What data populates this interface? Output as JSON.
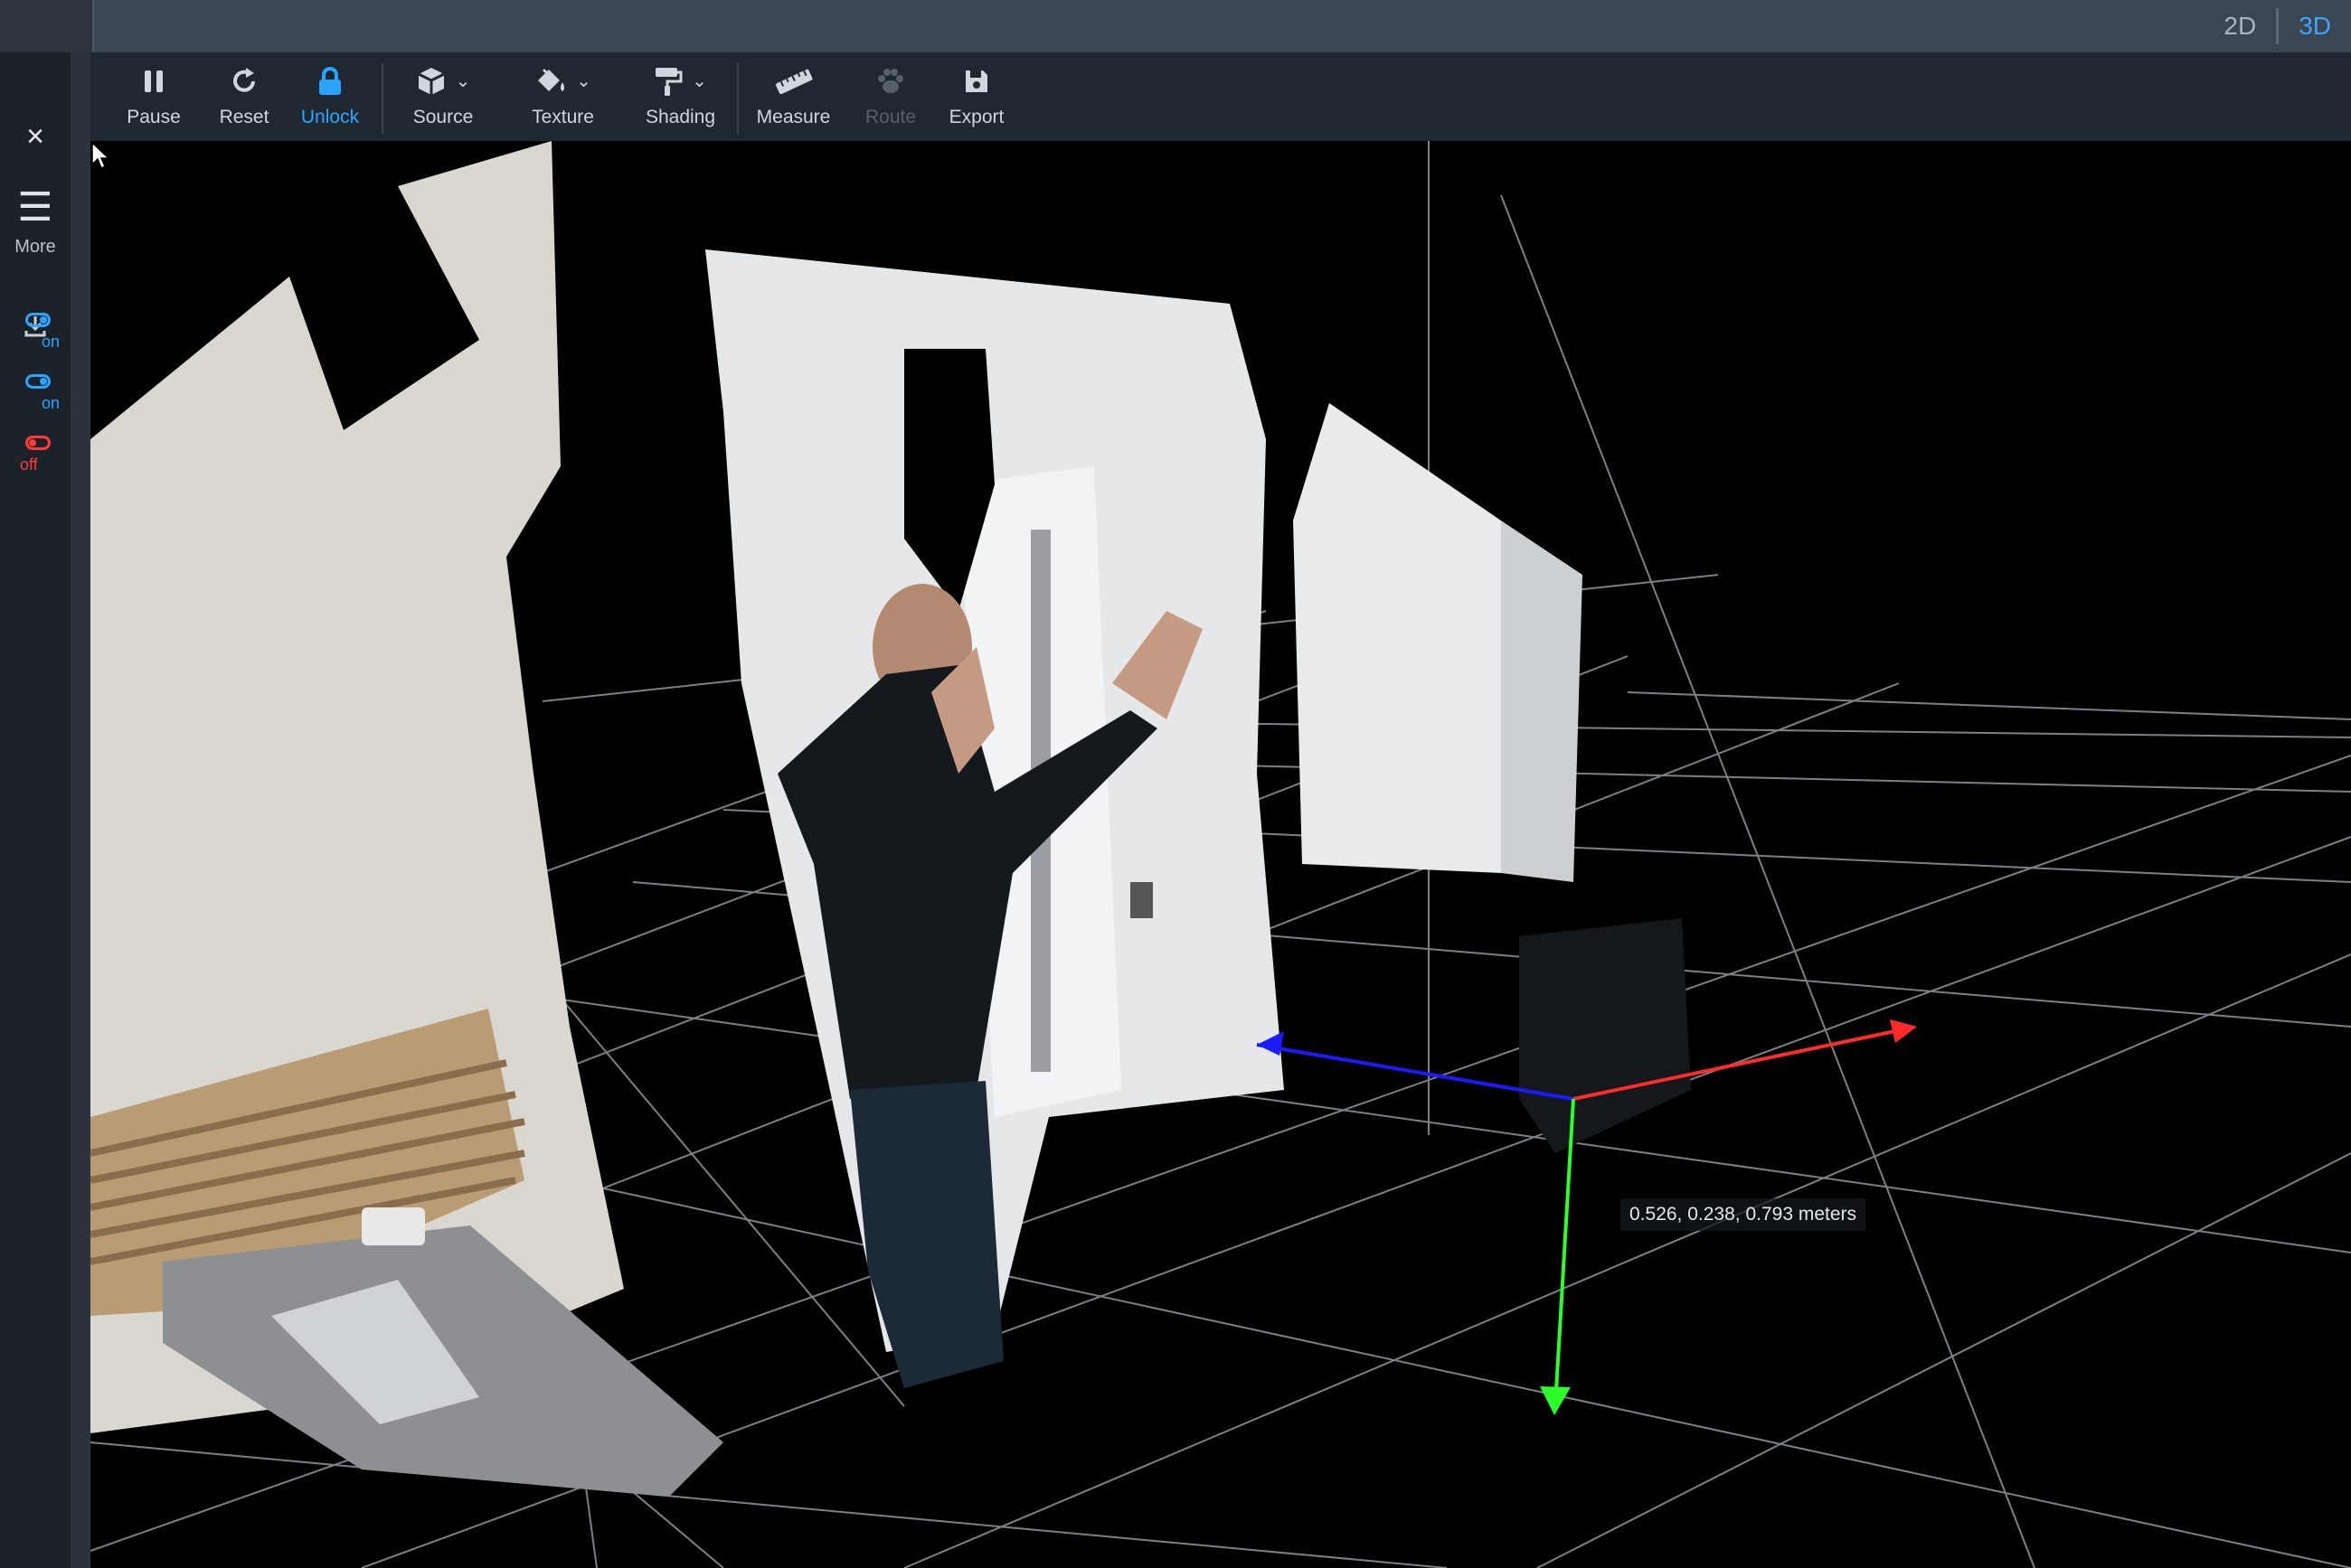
{
  "topbar": {
    "view_modes": [
      {
        "label": "2D",
        "active": false
      },
      {
        "label": "3D",
        "active": true
      }
    ]
  },
  "sidebar": {
    "close_glyph": "×",
    "more_label": "More",
    "toggles": [
      {
        "state": "on"
      },
      {
        "state": "on"
      },
      {
        "state": "off"
      }
    ]
  },
  "toolbar": {
    "tools": [
      {
        "label": "Pause",
        "icon": "pause-icon"
      },
      {
        "label": "Reset",
        "icon": "reset-icon"
      },
      {
        "label": "Unlock",
        "icon": "lock-icon",
        "active": true
      },
      {
        "label": "Source",
        "icon": "cube-icon",
        "dropdown": true
      },
      {
        "label": "Texture",
        "icon": "paint-bucket-icon",
        "dropdown": true
      },
      {
        "label": "Shading",
        "icon": "paint-roller-icon",
        "dropdown": true
      },
      {
        "label": "Measure",
        "icon": "ruler-icon"
      },
      {
        "label": "Route",
        "icon": "paw-icon",
        "disabled": true
      },
      {
        "label": "Export",
        "icon": "save-icon"
      }
    ]
  },
  "viewport": {
    "measurement": "0.526, 0.238, 0.793 meters",
    "axis_colors": {
      "x": "#ff2a2a",
      "y": "#2aff2a",
      "z": "#1a1aff"
    }
  },
  "colors": {
    "accent": "#2aa5ff",
    "off": "#ff3b3b",
    "toolbar": "#1f2830",
    "topbar": "#3a4652"
  }
}
